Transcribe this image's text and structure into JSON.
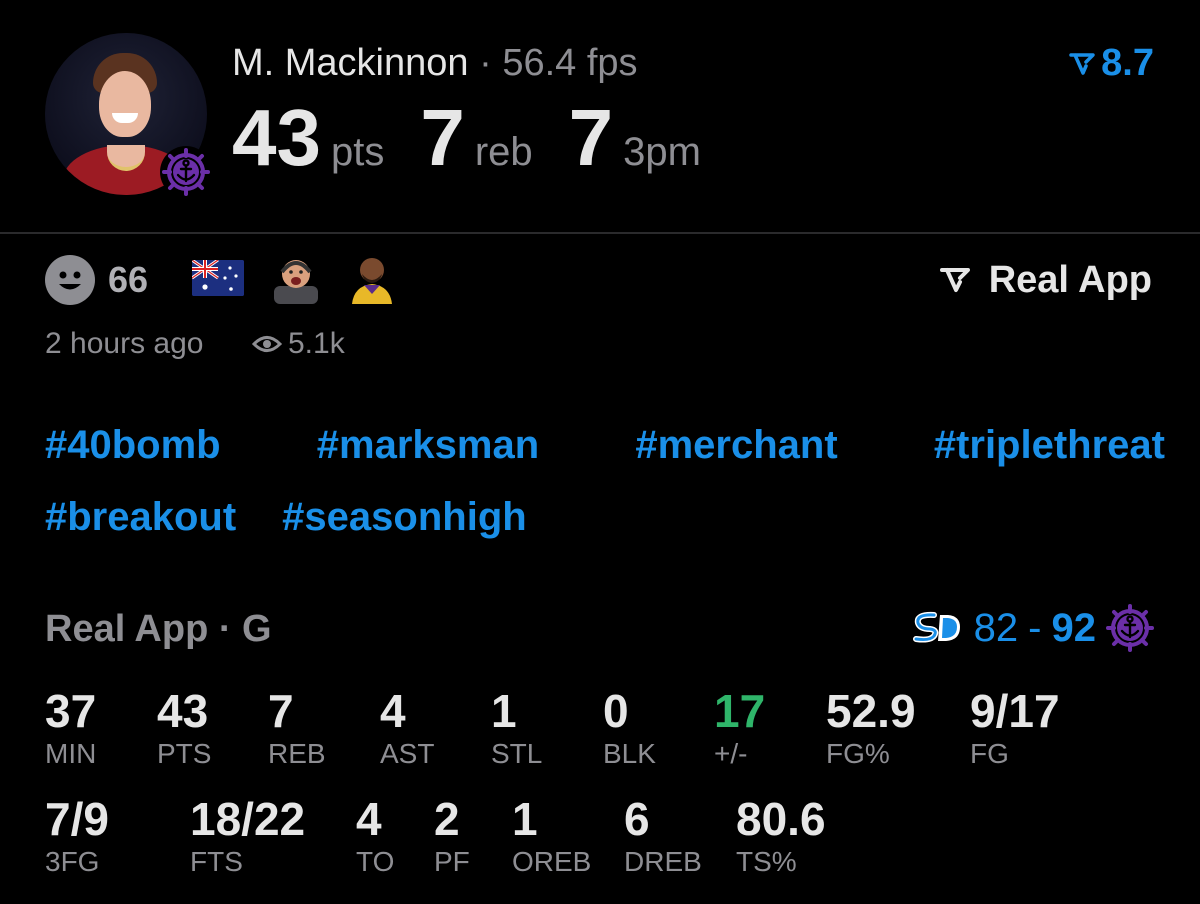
{
  "player": {
    "name": "M. Mackinnon",
    "sep": "·",
    "fps": "56.4 fps",
    "rating": "8.7",
    "highlights": [
      {
        "value": "43",
        "unit": "pts"
      },
      {
        "value": "7",
        "unit": "reb"
      },
      {
        "value": "7",
        "unit": "3pm"
      }
    ]
  },
  "meta": {
    "reactions_count": "66",
    "posted": "2 hours ago",
    "views": "5.1k",
    "brand": "Real App"
  },
  "hashtags": {
    "row1": [
      "#40bomb",
      "#marksman",
      "#merchant",
      "#triplethreat"
    ],
    "row2": [
      "#breakout",
      "#seasonhigh"
    ]
  },
  "game": {
    "source": "Real App · G",
    "away_score": "82",
    "dash": "-",
    "home_score": "92"
  },
  "box_score": {
    "row1": [
      {
        "value": "37",
        "label": "MIN"
      },
      {
        "value": "43",
        "label": "PTS"
      },
      {
        "value": "7",
        "label": "REB"
      },
      {
        "value": "4",
        "label": "AST"
      },
      {
        "value": "1",
        "label": "STL"
      },
      {
        "value": "0",
        "label": "BLK"
      },
      {
        "value": "17",
        "label": "+/-"
      },
      {
        "value": "52.9",
        "label": "FG%"
      },
      {
        "value": "9/17",
        "label": "FG"
      }
    ],
    "row2": [
      {
        "value": "7/9",
        "label": "3FG"
      },
      {
        "value": "18/22",
        "label": "FTS"
      },
      {
        "value": "4",
        "label": "TO"
      },
      {
        "value": "2",
        "label": "PF"
      },
      {
        "value": "1",
        "label": "OREB"
      },
      {
        "value": "6",
        "label": "DREB"
      },
      {
        "value": "80.6",
        "label": "TS%"
      }
    ]
  },
  "colors": {
    "accent": "#1a8fe8",
    "positive": "#2fb56a",
    "muted": "#8e8e93",
    "background": "#000000"
  }
}
